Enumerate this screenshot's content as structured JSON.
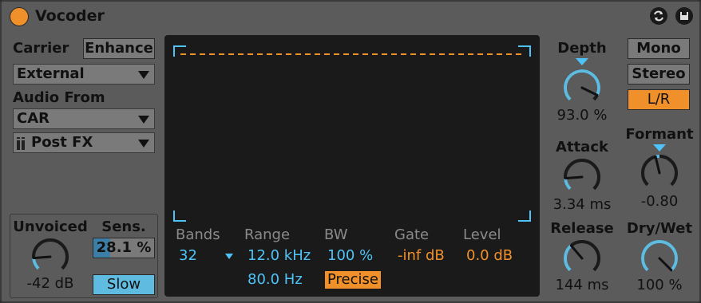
{
  "colors": {
    "accent": "#f0902b",
    "cyan": "#4fc3f7",
    "panel": "#5b5b5b",
    "display_bg": "#1a1a1a"
  },
  "title": "Vocoder",
  "header_icons": [
    "swap-icon",
    "save-icon"
  ],
  "carrier": {
    "label": "Carrier",
    "enhance_label": "Enhance",
    "carrier_value": "External",
    "audio_from_label": "Audio From",
    "audio_from_value": "CAR",
    "tap_value": "Post FX"
  },
  "unvoiced": {
    "label": "Unvoiced",
    "value": "-42 dB",
    "level": 0.15
  },
  "sens": {
    "label": "Sens.",
    "value": "28.1 %",
    "level": 0.281,
    "slow_label": "Slow"
  },
  "display": {
    "bands_label": "Bands",
    "bands_value": "32",
    "range_label": "Range",
    "range_high": "12.0 kHz",
    "range_low": "80.0 Hz",
    "bw_label": "BW",
    "bw_value": "100 %",
    "precise_label": "Precise",
    "gate_label": "Gate",
    "gate_value": "-inf dB",
    "level_label": "Level",
    "level_value": "0.0 dB"
  },
  "depth": {
    "label": "Depth",
    "value": "93.0 %",
    "level": 0.93
  },
  "attack": {
    "label": "Attack",
    "value": "3.34 ms",
    "level": 0.15
  },
  "release": {
    "label": "Release",
    "value": "144 ms",
    "level": 0.35
  },
  "channels": {
    "mono": "Mono",
    "stereo": "Stereo",
    "lr": "L/R",
    "selected": "L/R"
  },
  "formant": {
    "label": "Formant",
    "value": "-0.80",
    "level": 0.45
  },
  "drywet": {
    "label": "Dry/Wet",
    "value": "100 %",
    "level": 1.0
  }
}
